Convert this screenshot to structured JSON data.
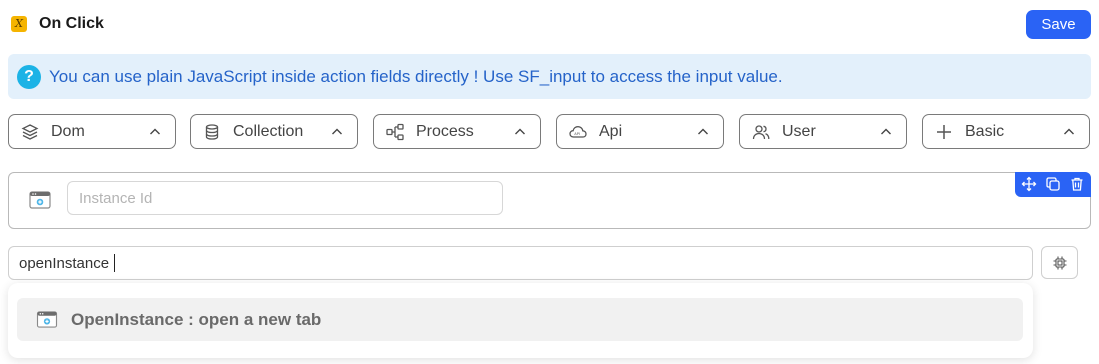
{
  "header": {
    "title": "On Click",
    "logo_glyph": "X",
    "save_label": "Save"
  },
  "info": {
    "text": "You can use plain JavaScript inside action fields directly ! Use SF_input to access the input value.",
    "icon": "question-icon",
    "icon_glyph": "?"
  },
  "categories": [
    {
      "label": "Dom",
      "icon": "layers-icon"
    },
    {
      "label": "Collection",
      "icon": "database-icon"
    },
    {
      "label": "Process",
      "icon": "workflow-icon"
    },
    {
      "label": "Api",
      "icon": "cloud-api-icon"
    },
    {
      "label": "User",
      "icon": "users-icon"
    },
    {
      "label": "Basic",
      "icon": "plus-icon"
    }
  ],
  "action_card": {
    "input_placeholder": "Instance Id",
    "input_value": "",
    "icon": "browser-tab-icon",
    "tools": [
      "move-icon",
      "copy-icon",
      "trash-icon"
    ]
  },
  "search": {
    "value": "openInstance"
  },
  "dropdown": {
    "items": [
      {
        "label": "OpenInstance : open a new tab",
        "icon": "browser-tab-icon"
      }
    ]
  },
  "colors": {
    "accent": "#2a63f5",
    "info_bg": "#e3f0fb",
    "info_text": "#2563c9",
    "logo": "#f5b400"
  }
}
